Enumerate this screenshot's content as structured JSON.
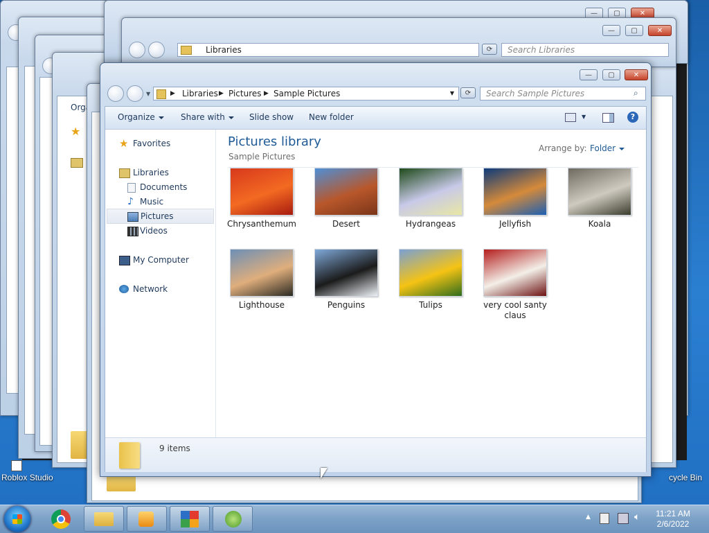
{
  "desktop": {
    "icons": [
      {
        "label": "Roblox Studio"
      },
      {
        "label": "cycle Bin"
      }
    ]
  },
  "background_windows": {
    "libraries_address": "Libraries",
    "libraries_search_placeholder": "Search Libraries",
    "partial_menu": "Orga"
  },
  "window": {
    "breadcrumb": [
      "Libraries",
      "Pictures",
      "Sample Pictures"
    ],
    "search_placeholder": "Search Sample Pictures",
    "toolbar": {
      "organize": "Organize",
      "share_with": "Share with",
      "slide_show": "Slide show",
      "new_folder": "New folder"
    },
    "nav": {
      "favorites": "Favorites",
      "libraries": "Libraries",
      "documents": "Documents",
      "music": "Music",
      "pictures": "Pictures",
      "videos": "Videos",
      "my_computer": "My Computer",
      "network": "Network"
    },
    "library": {
      "title": "Pictures library",
      "subtitle": "Sample Pictures",
      "arrange_label": "Arrange by:",
      "arrange_value": "Folder"
    },
    "items": [
      {
        "name": "Chrysanthemum",
        "colors": [
          "#d7391c",
          "#f36a22",
          "#a71b0f"
        ]
      },
      {
        "name": "Desert",
        "colors": [
          "#4f8fd6",
          "#b8572b",
          "#7b3518"
        ]
      },
      {
        "name": "Hydrangeas",
        "colors": [
          "#1f4a1a",
          "#c8c9e8",
          "#e8e7a4"
        ]
      },
      {
        "name": "Jellyfish",
        "colors": [
          "#0d3a7a",
          "#d58a3a",
          "#1c5fb2"
        ]
      },
      {
        "name": "Koala",
        "colors": [
          "#6e6a60",
          "#cfcac0",
          "#3b3d2d"
        ]
      },
      {
        "name": "Lighthouse",
        "colors": [
          "#6d8fb6",
          "#dfae7c",
          "#2b2a22"
        ]
      },
      {
        "name": "Penguins",
        "colors": [
          "#7fa9d9",
          "#1b1b1b",
          "#eef2f6"
        ]
      },
      {
        "name": "Tulips",
        "colors": [
          "#7aa0d4",
          "#f5c314",
          "#2f6d1c"
        ]
      },
      {
        "name": "very cool santy claus",
        "colors": [
          "#b41e1e",
          "#f3efe8",
          "#6d1212"
        ]
      }
    ],
    "status": {
      "item_count": "9 items"
    }
  },
  "taskbar": {
    "clock_time": "11:21 AM",
    "clock_date": "2/6/2022"
  }
}
